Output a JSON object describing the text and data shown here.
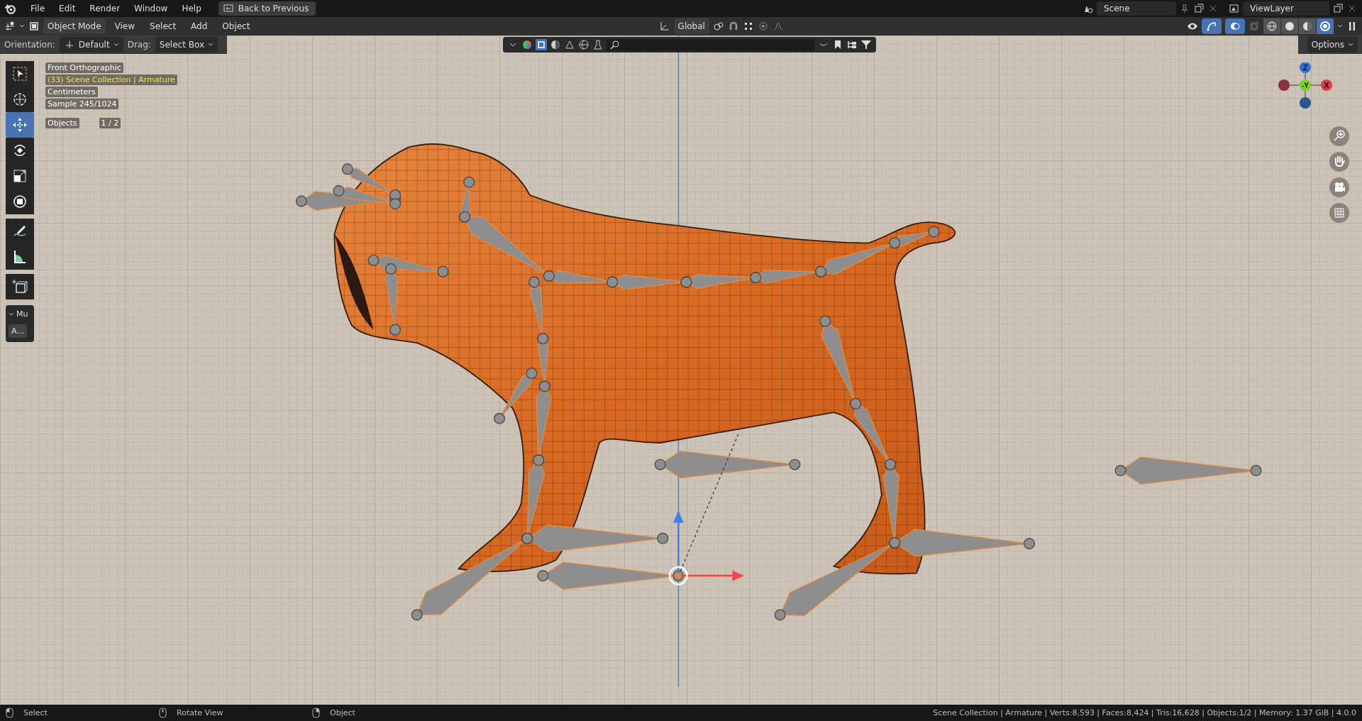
{
  "topbar": {
    "menus": [
      "File",
      "Edit",
      "Render",
      "Window",
      "Help"
    ],
    "back_button": "Back to Previous",
    "scene": "Scene",
    "view_layer": "ViewLayer"
  },
  "header": {
    "mode": "Object Mode",
    "menus": [
      "View",
      "Select",
      "Add",
      "Object"
    ],
    "orientation": "Global",
    "shading": [
      {
        "kind": "wireframe",
        "selected": false
      },
      {
        "kind": "solid",
        "selected": false
      },
      {
        "kind": "material",
        "selected": false
      },
      {
        "kind": "rendered",
        "selected": true
      }
    ]
  },
  "tool_settings": {
    "orientation_label": "Orientation:",
    "orientation": "Default",
    "drag_label": "Drag:",
    "drag": "Select Box",
    "options": "Options"
  },
  "toolbar": {
    "tools": [
      {
        "kind": "select-box",
        "selected": false
      },
      {
        "kind": "cursor",
        "selected": false
      },
      {
        "kind": "move",
        "selected": true
      },
      {
        "kind": "rotate",
        "selected": false
      },
      {
        "kind": "scale",
        "selected": false
      },
      {
        "kind": "transform",
        "selected": false
      },
      {
        "kind": "annotate",
        "selected": false
      },
      {
        "kind": "measure",
        "selected": false
      },
      {
        "kind": "add-cube",
        "selected": false
      }
    ],
    "panel_title": "Mu",
    "panel_button": "A..."
  },
  "overlay": {
    "view": "Front Orthographic",
    "collection": "(33) Scene Collection | Armature",
    "units": "Centimeters",
    "sample": "Sample 245/1024",
    "objects_label": "Objects",
    "objects_value": "1 / 2"
  },
  "nav_gizmo": {
    "z": "Z",
    "y": "-Y",
    "x": "X"
  },
  "status_bar": {
    "hints": [
      {
        "kind": "left",
        "text": "Select"
      },
      {
        "kind": "middle",
        "text": "Rotate View"
      },
      {
        "kind": "right",
        "text": "Object"
      }
    ],
    "stats": "Scene Collection | Armature | Verts:8,593 | Faces:8,424 | Tris:16,628 | Objects:1/2 | Memory: 1.37 GiB | 4.0.0"
  }
}
